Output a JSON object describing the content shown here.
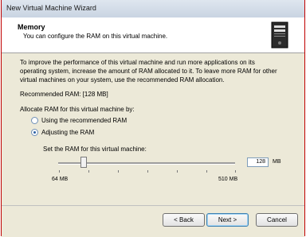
{
  "window": {
    "title": "New Virtual Machine Wizard"
  },
  "header": {
    "title": "Memory",
    "subtitle": "You can configure the RAM on this virtual machine.",
    "icon": "computer-tower-icon"
  },
  "body": {
    "description": "To improve the performance of this virtual machine and run more applications on its operating system, increase the amount of RAM allocated to it. To leave more RAM for other virtual machines on your system, use the recommended RAM allocation.",
    "recommended": "Recommended RAM:  [128 MB]",
    "allocate_label": "Allocate RAM for this virtual machine by:",
    "options": [
      {
        "label": "Using the recommended RAM",
        "selected": false
      },
      {
        "label": "Adjusting the RAM",
        "selected": true
      }
    ],
    "set_label": "Set the RAM for this virtual machine:",
    "slider": {
      "min_label": "64 MB",
      "max_label": "510 MB",
      "value": 128,
      "min": 64,
      "max": 510
    },
    "ram_value": "128",
    "ram_unit": "MB"
  },
  "footer": {
    "back": "< Back",
    "next": "Next >",
    "cancel": "Cancel"
  }
}
